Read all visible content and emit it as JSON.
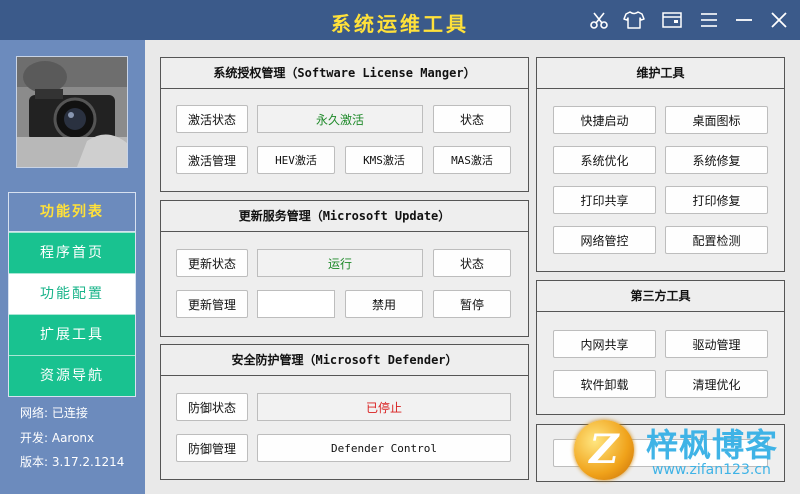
{
  "window": {
    "title": "系统运维工具"
  },
  "titlebar": {
    "icons": [
      "scissors-icon",
      "shirt-icon",
      "wallet-icon",
      "menu-icon",
      "minimize-icon",
      "close-icon"
    ]
  },
  "sidebar": {
    "menu_title": "功能列表",
    "items": [
      {
        "label": "程序首页",
        "active": false
      },
      {
        "label": "功能配置",
        "active": true
      },
      {
        "label": "扩展工具",
        "active": false
      },
      {
        "label": "资源导航",
        "active": false
      }
    ],
    "network": "网络: 已连接",
    "developer": "开发: Aaronx",
    "version": "版本: 3.17.2.1214"
  },
  "license": {
    "title": "系统授权管理（Software License Manger）",
    "status_label": "激活状态",
    "status_value": "永久激活",
    "status_btn": "状态",
    "manage_label": "激活管理",
    "hev_btn": "HEV激活",
    "kms_btn": "KMS激活",
    "mas_btn": "MAS激活"
  },
  "update": {
    "title": "更新服务管理（Microsoft Update）",
    "status_label": "更新状态",
    "status_value": "运行",
    "status_btn": "状态",
    "manage_label": "更新管理",
    "disable_btn": "禁用",
    "pause_btn": "暂停"
  },
  "defender": {
    "title": "安全防护管理（Microsoft Defender）",
    "status_label": "防御状态",
    "status_value": "已停止",
    "manage_label": "防御管理",
    "control_btn": "Defender Control"
  },
  "maintenance": {
    "title": "维护工具",
    "buttons": [
      "快捷启动",
      "桌面图标",
      "系统优化",
      "系统修复",
      "打印共享",
      "打印修复",
      "网络管控",
      "配置检测"
    ]
  },
  "thirdparty": {
    "title": "第三方工具",
    "buttons": [
      "内网共享",
      "驱动管理",
      "软件卸载",
      "清理优化"
    ]
  },
  "watermark": {
    "name": "梓枫博客",
    "url": "www.zifan123.cn",
    "logo_letter": "Z"
  },
  "colors": {
    "titlebar": "#3b5a8a",
    "sidebar": "#6c8bbd",
    "menu_green": "#19c290",
    "title_yellow": "#ffe13a",
    "status_green": "#1f8a2a",
    "status_red": "#d92020"
  }
}
